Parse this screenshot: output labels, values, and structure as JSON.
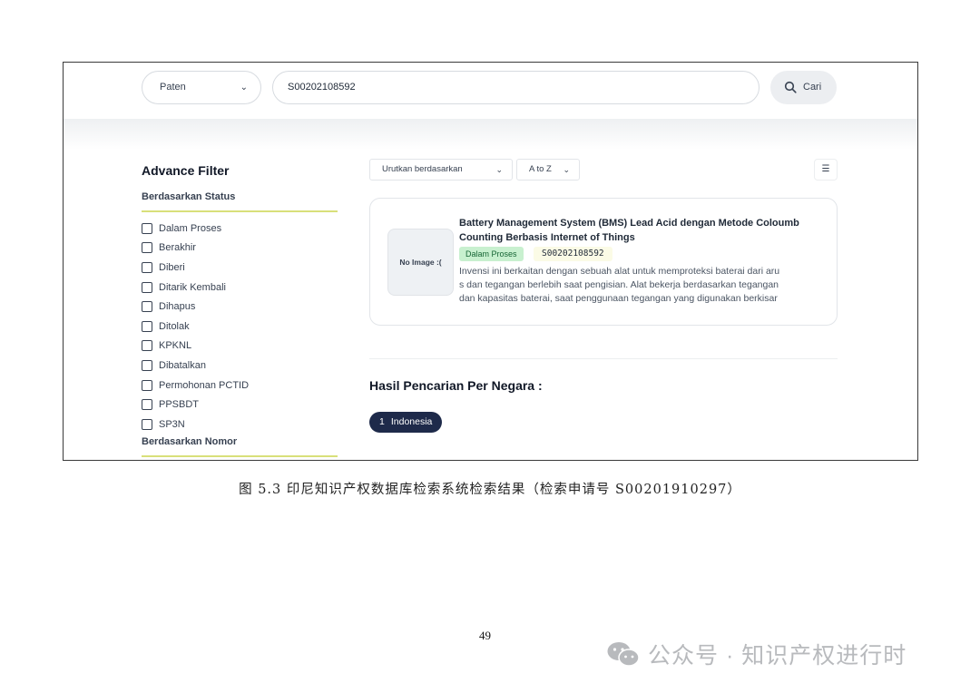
{
  "search_bar": {
    "type_value": "Paten",
    "query_value": "S00202108592",
    "search_label": "Cari"
  },
  "filter": {
    "title": "Advance Filter",
    "status_heading": "Berdasarkan Status",
    "status_options": [
      "Dalam Proses",
      "Berakhir",
      "Diberi",
      "Ditarik Kembali",
      "Dihapus",
      "Ditolak",
      "KPKNL",
      "Dibatalkan",
      "Permohonan PCTID",
      "PPSBDT",
      "SP3N"
    ],
    "number_heading": "Berdasarkan Nomor"
  },
  "sort": {
    "sort_by_label": "Urutkan berdasarkan",
    "order_label": "A to Z"
  },
  "result": {
    "no_image_label": "No Image :(",
    "title": "Battery Management System (BMS) Lead Acid dengan Metode Coloumb Counting Berbasis Internet of Things",
    "status": "Dalam Proses",
    "number": "S00202108592",
    "abstract_lines": [
      "Invensi ini berkaitan dengan sebuah alat untuk memproteksi baterai dari aru",
      "s dan tegangan berlebih saat pengisian. Alat bekerja berdasarkan tegangan",
      "dan kapasitas baterai, saat penggunaan tegangan yang digunakan berkisar"
    ]
  },
  "country": {
    "heading": "Hasil Pencarian Per Negara :",
    "items": [
      {
        "count": "1",
        "name": "Indonesia"
      }
    ]
  },
  "caption": "图 5.3  印尼知识产权数据库检索系统检索结果（检索申请号 S00201910297）",
  "page_number": "49",
  "watermark": "公众号 · 知识产权进行时",
  "icons": {
    "search": "search-icon",
    "dropdown": "chevron-down-icon",
    "list_view": "list-view-icon",
    "watermark_logo": "wechat-icon"
  },
  "colors": {
    "status_badge_bg": "#c8f0cf",
    "country_pill_bg": "#1e2a4a",
    "filter_underline": "#d8e07a"
  }
}
